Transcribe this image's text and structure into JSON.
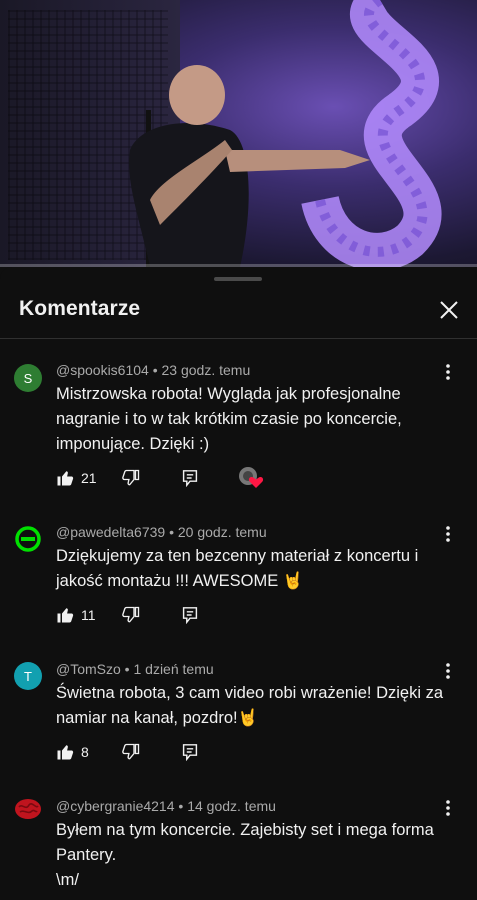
{
  "panel": {
    "title": "Komentarze"
  },
  "comments": [
    {
      "author": "@spookis6104",
      "time": "23 godz. temu",
      "text_lines": [
        "Mistrzowska robota! Wygląda jak profesjonalne",
        "nagranie i to w tak krótkim czasie po koncercie,",
        "imponujące. Dzięki :)"
      ],
      "likes": "21",
      "avatar_letter": "S",
      "avatar_color": "#2e7d32",
      "creator_heart": true
    },
    {
      "author": "@pawedelta6739",
      "time": "20 godz. temu",
      "text_lines": [
        "Dziękujemy za ten bezcenny materiał z koncertu i",
        "jakość montażu !!! AWESOME 🤘"
      ],
      "likes": "11",
      "avatar_letter": "",
      "avatar_color": "#00e000",
      "creator_heart": false
    },
    {
      "author": "@TomSzo",
      "time": "1 dzień temu",
      "text_lines": [
        "Świetna robota, 3 cam video robi wrażenie! Dzięki za",
        "namiar na kanał, pozdro!🤘"
      ],
      "likes": "8",
      "avatar_letter": "T",
      "avatar_color": "#12a0b0",
      "creator_heart": false
    },
    {
      "author": "@cybergranie4214",
      "time": "14 godz. temu",
      "text_lines": [
        "Byłem na tym koncercie. Zajebisty set i mega forma",
        "Pantery.",
        "\\m/"
      ],
      "likes": "",
      "avatar_letter": "",
      "avatar_color": "#c0141e",
      "creator_heart": false
    }
  ],
  "separator": " • ",
  "colors": {
    "background": "#0f0f0f",
    "meta": "#aaaaaa",
    "text": "#f1f1f1",
    "heart": "#ff1744"
  }
}
